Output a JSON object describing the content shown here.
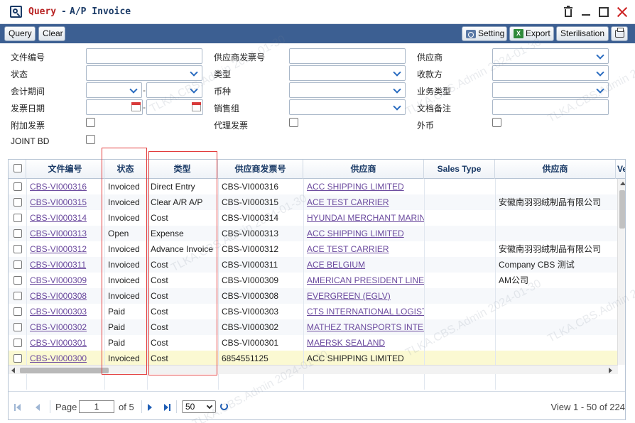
{
  "window": {
    "title_query": "Query",
    "title_sep": "-",
    "title_rest": "A/P Invoice"
  },
  "toolbar": {
    "query": "Query",
    "clear": "Clear",
    "setting": "Setting",
    "export": "Export",
    "sterilisation": "Sterilisation"
  },
  "filters": {
    "doc_no": "文件编号",
    "status": "状态",
    "period": "会计期间",
    "invoice_date": "发票日期",
    "attach_invoice": "附加发票",
    "joint_bd": "JOINT BD",
    "vendor_invoice_no": "供应商发票号",
    "type": "类型",
    "currency": "币种",
    "sales_group": "销售组",
    "agent_invoice": "代理发票",
    "vendor": "供应商",
    "payee": "收款方",
    "business_type": "业务类型",
    "doc_remark": "文档备注",
    "foreign_currency": "外币",
    "dash": "-"
  },
  "grid": {
    "headers": [
      "文件编号",
      "状态",
      "类型",
      "供应商发票号",
      "供应商",
      "Sales Type",
      "供应商",
      "Ve"
    ],
    "rows": [
      {
        "doc": "CBS-VI000316",
        "status": "Invoiced",
        "type": "Direct Entry",
        "vinv": "CBS-VI000316",
        "vendor": "ACC SHIPPING LIMITED",
        "sales": "",
        "vendor2": ""
      },
      {
        "doc": "CBS-VI000315",
        "status": "Invoiced",
        "type": "Clear A/R A/P",
        "vinv": "CBS-VI000315",
        "vendor": "ACE TEST CARRIER",
        "sales": "",
        "vendor2": "安徽南羽羽绒制品有限公司"
      },
      {
        "doc": "CBS-VI000314",
        "status": "Invoiced",
        "type": "Cost",
        "vinv": "CBS-VI000314",
        "vendor": "HYUNDAI MERCHANT MARINE",
        "sales": "",
        "vendor2": ""
      },
      {
        "doc": "CBS-VI000313",
        "status": "Open",
        "type": "Expense",
        "vinv": "CBS-VI000313",
        "vendor": "ACC SHIPPING LIMITED",
        "sales": "",
        "vendor2": ""
      },
      {
        "doc": "CBS-VI000312",
        "status": "Invoiced",
        "type": "Advance Invoice",
        "vinv": "CBS-VI000312",
        "vendor": "ACE TEST CARRIER",
        "sales": "",
        "vendor2": "安徽南羽羽绒制品有限公司"
      },
      {
        "doc": "CBS-VI000311",
        "status": "Invoiced",
        "type": "Cost",
        "vinv": "CBS-VI000311",
        "vendor": "ACE BELGIUM",
        "sales": "",
        "vendor2": "Company CBS 测试"
      },
      {
        "doc": "CBS-VI000309",
        "status": "Invoiced",
        "type": "Cost",
        "vinv": "CBS-VI000309",
        "vendor": "AMERICAN PRESIDENT LINES",
        "sales": "",
        "vendor2": "AM公司"
      },
      {
        "doc": "CBS-VI000308",
        "status": "Invoiced",
        "type": "Cost",
        "vinv": "CBS-VI000308",
        "vendor": "EVERGREEN (EGLV)",
        "sales": "",
        "vendor2": ""
      },
      {
        "doc": "CBS-VI000303",
        "status": "Paid",
        "type": "Cost",
        "vinv": "CBS-VI000303",
        "vendor": "CTS INTERNATIONAL LOGISTICS",
        "sales": "",
        "vendor2": ""
      },
      {
        "doc": "CBS-VI000302",
        "status": "Paid",
        "type": "Cost",
        "vinv": "CBS-VI000302",
        "vendor": "MATHEZ TRANSPORTS INTERNATIONAL",
        "sales": "",
        "vendor2": ""
      },
      {
        "doc": "CBS-VI000301",
        "status": "Paid",
        "type": "Cost",
        "vinv": "CBS-VI000301",
        "vendor": "MAERSK SEALAND",
        "sales": "",
        "vendor2": ""
      },
      {
        "doc": "CBS-VI000300",
        "status": "Invoiced",
        "type": "Cost",
        "vinv": "6854551125",
        "vendor": "ACC SHIPPING LIMITED",
        "sales": "",
        "vendor2": ""
      }
    ]
  },
  "pager": {
    "page_label": "Page",
    "page_value": "1",
    "of_label": "of 5",
    "page_size": "50",
    "view_text": "View 1 - 50 of 224"
  },
  "watermark": {
    "text": "TLKA.CBS.Admin 2024-01-30"
  },
  "colors": {
    "toolbar_bg": "#3c5f92",
    "title_red": "#b82222",
    "title_navy": "#1a3a66",
    "link": "#6b4a9e",
    "highlight": "#e23b3b"
  }
}
